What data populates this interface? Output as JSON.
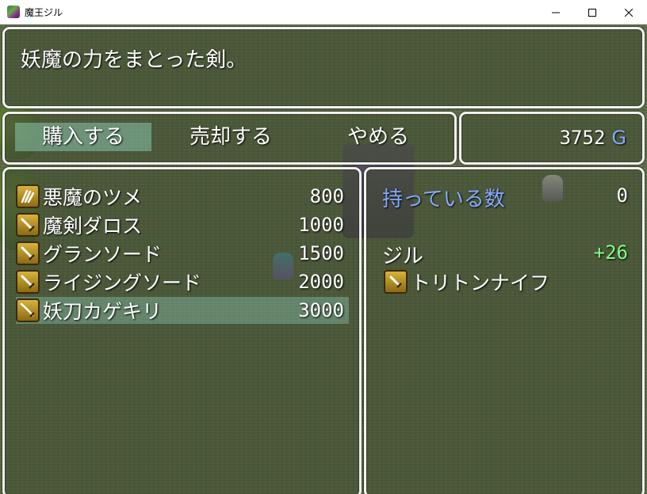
{
  "window": {
    "title": "魔王ジル",
    "icon": "app-icon",
    "controls": [
      "minimize-icon",
      "maximize-icon",
      "close-icon"
    ]
  },
  "help": {
    "text": "妖魔の力をまとった剣。"
  },
  "commands": [
    {
      "label": "購入する",
      "selected": true
    },
    {
      "label": "売却する",
      "selected": false
    },
    {
      "label": "やめる",
      "selected": false
    }
  ],
  "gold": {
    "amount": "3752",
    "unit": "G",
    "unit_color": "#84aaff"
  },
  "buy_list": [
    {
      "name": "悪魔のツメ",
      "price": "800",
      "icon": "claw-icon",
      "selected": false
    },
    {
      "name": "魔剣ダロス",
      "price": "1000",
      "icon": "sword-icon",
      "selected": false
    },
    {
      "name": "グランソード",
      "price": "1500",
      "icon": "sword-icon",
      "selected": false
    },
    {
      "name": "ライジングソード",
      "price": "2000",
      "icon": "sword-icon",
      "selected": false
    },
    {
      "name": "妖刀カゲキリ",
      "price": "3000",
      "icon": "katana-icon",
      "selected": true
    }
  ],
  "status": {
    "possession_label": "持っている数",
    "possession_value": "0",
    "label_color": "#84aaff",
    "actor_name": "ジル",
    "param_change": "+26",
    "change_color": "#80ff80",
    "equipped_item": "トリトンナイフ",
    "equipped_icon": "dagger-icon"
  }
}
